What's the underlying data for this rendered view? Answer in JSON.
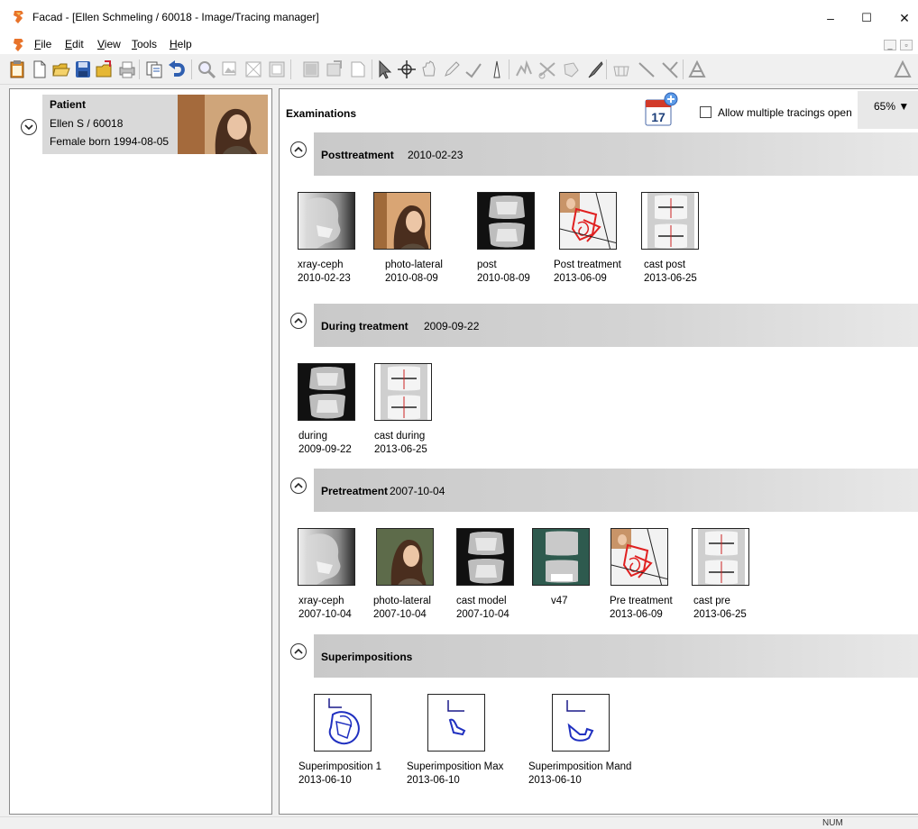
{
  "window": {
    "title": "Facad - [Ellen Schmeling / 60018 - Image/Tracing manager]",
    "minimize_glyph": "–",
    "maximize_glyph": "☐",
    "close_glyph": "✕"
  },
  "menu": {
    "file": {
      "key": "F",
      "rest": "ile"
    },
    "edit": {
      "key": "E",
      "rest": "dit"
    },
    "view": {
      "key": "V",
      "rest": "iew"
    },
    "tools": {
      "key": "T",
      "rest": "ools"
    },
    "help": {
      "key": "H",
      "rest": "elp"
    },
    "mdi_minimize": "_",
    "mdi_restore": "▫"
  },
  "toolbar": {
    "icons": [
      "clipboard-icon",
      "new-document-icon",
      "open-folder-icon",
      "save-icon",
      "export-folder-icon",
      "print-icon",
      "copy-page-icon",
      "undo-icon",
      "zoom-icon",
      "image-select-icon",
      "fit-icon",
      "grid-icon",
      "picture-icon",
      "tile-icon",
      "page-icon",
      "arrow-pointer-icon",
      "crosshair-icon",
      "hand-icon",
      "pen-icon",
      "angle-icon",
      "caliper-icon",
      "tooth-icon",
      "cut-icon",
      "rotate-icon",
      "brush-icon",
      "teeth-icon",
      "line-icon",
      "cross-lines-icon",
      "triangle-icon",
      "triangle-outline-icon"
    ]
  },
  "patient": {
    "label": "Patient",
    "name_id": "Ellen S / 60018",
    "details": "Female born 1994-08-05"
  },
  "examinations": {
    "title": "Examinations",
    "calendar_day": "17",
    "allow_multiple_label": "Allow multiple tracings open",
    "allow_multiple_checked": false,
    "zoom": "65% ▼"
  },
  "sections": [
    {
      "name": "Posttreatment",
      "date": "2010-02-23",
      "items": [
        {
          "name": "xray-ceph",
          "date": "2010-02-23",
          "kind": "xray"
        },
        {
          "name": "photo-lateral",
          "date": "2010-08-09",
          "kind": "photo"
        },
        {
          "name": "post",
          "date": "2010-08-09",
          "kind": "cast-dark"
        },
        {
          "name": "Post treatment",
          "date": "2013-06-09",
          "kind": "tracing"
        },
        {
          "name": "cast post",
          "date": "2013-06-25",
          "kind": "cast-light"
        }
      ]
    },
    {
      "name": "During treatment",
      "date": "2009-09-22",
      "items": [
        {
          "name": "during",
          "date": "2009-09-22",
          "kind": "cast-dark"
        },
        {
          "name": "cast during",
          "date": "2013-06-25",
          "kind": "cast-light"
        }
      ]
    },
    {
      "name": "Pretreatment",
      "date": "2007-10-04",
      "items": [
        {
          "name": "xray-ceph",
          "date": "2007-10-04",
          "kind": "xray"
        },
        {
          "name": "photo-lateral",
          "date": "2007-10-04",
          "kind": "photo-green"
        },
        {
          "name": "cast model",
          "date": "2007-10-04",
          "kind": "cast-dark"
        },
        {
          "name": "v47",
          "date": "",
          "kind": "cast-green"
        },
        {
          "name": "Pre treatment",
          "date": "2013-06-09",
          "kind": "tracing"
        },
        {
          "name": "cast pre",
          "date": "2013-06-25",
          "kind": "cast-light"
        }
      ]
    },
    {
      "name": "Superimpositions",
      "date": "",
      "items": [
        {
          "name": "Superimposition 1",
          "date": "2013-06-10",
          "kind": "super-full"
        },
        {
          "name": "Superimposition Max",
          "date": "2013-06-10",
          "kind": "super-max"
        },
        {
          "name": "Superimposition Mand",
          "date": "2013-06-10",
          "kind": "super-mand"
        }
      ]
    }
  ],
  "status": {
    "num": "NUM"
  }
}
